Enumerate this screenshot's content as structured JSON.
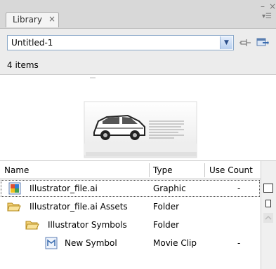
{
  "panel": {
    "tab_label": "Library",
    "tab_close": "×",
    "window_minimize": "–",
    "window_close": "×",
    "menu_glyph": "▾☰"
  },
  "document": {
    "selected": "Untitled-1"
  },
  "item_count": "4 items",
  "columns": {
    "name": "Name",
    "type": "Type",
    "use_count": "Use Count",
    "sort_indicator": "▲"
  },
  "rows": [
    {
      "name": "Illustrator_file.ai",
      "type": "Graphic",
      "use_count": "-",
      "icon": "graphic-icon",
      "selected": true
    },
    {
      "name": "Illustrator_file.ai Assets",
      "type": "Folder",
      "use_count": "",
      "icon": "folder-icon"
    },
    {
      "name": "Illustrator Symbols",
      "type": "Folder",
      "use_count": "",
      "icon": "folder-icon"
    },
    {
      "name": "New Symbol",
      "type": "Movie Clip",
      "use_count": "-",
      "icon": "movieclip-icon"
    }
  ],
  "colors": {
    "panel_bg": "#ececec",
    "folder": "#e0b030",
    "accent": "#4a78c0"
  }
}
